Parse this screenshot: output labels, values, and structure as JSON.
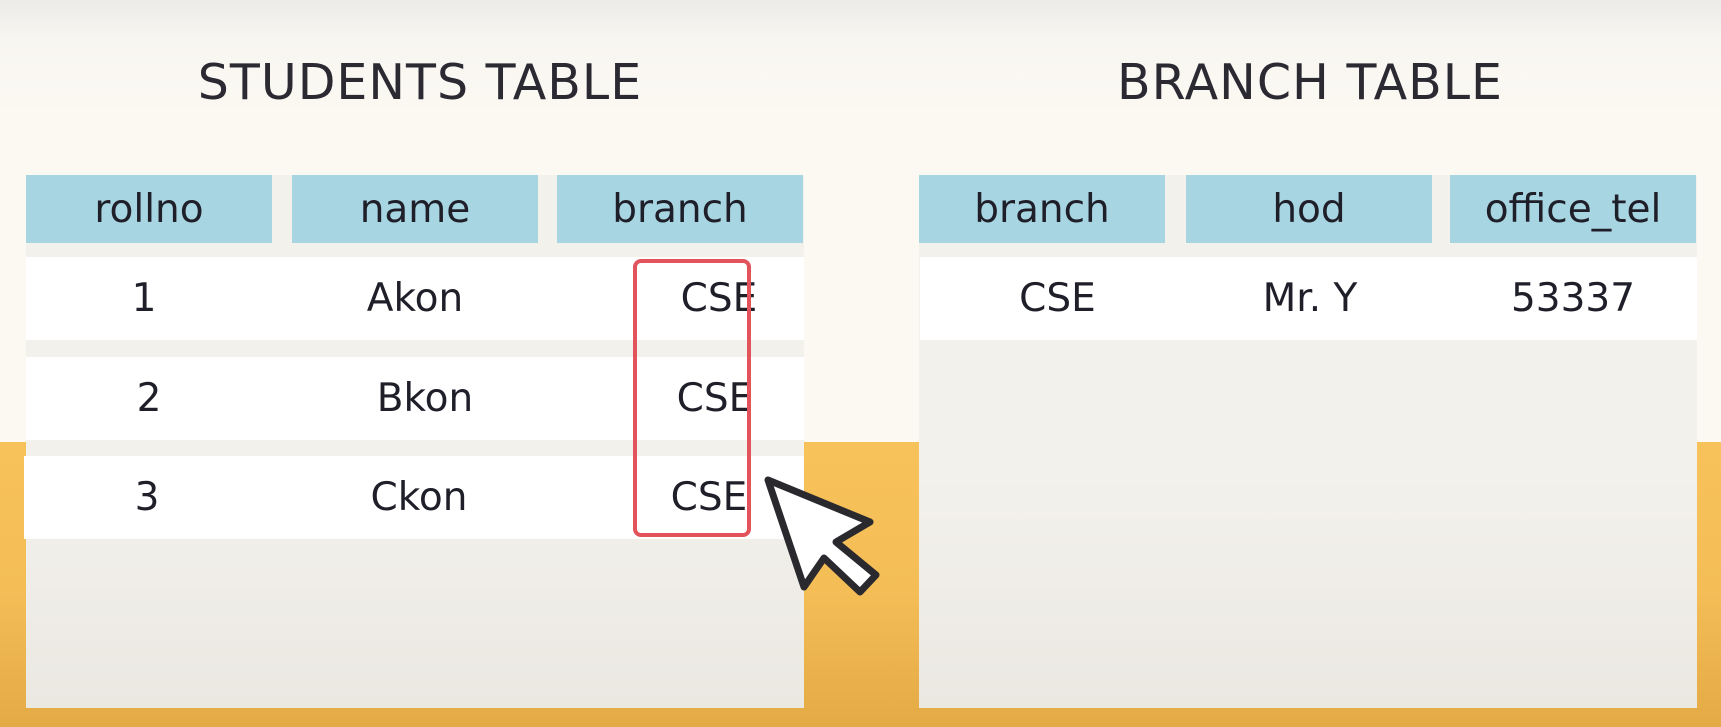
{
  "students": {
    "title": "STUDENTS TABLE",
    "columns": [
      "rollno",
      "name",
      "branch"
    ],
    "rows": [
      [
        "1",
        "Akon",
        "CSE"
      ],
      [
        "2",
        "Bkon",
        "CSE"
      ],
      [
        "3",
        "Ckon",
        "CSE"
      ]
    ]
  },
  "branch": {
    "title": "BRANCH TABLE",
    "columns": [
      "branch",
      "hod",
      "office_tel"
    ],
    "rows": [
      [
        "CSE",
        "Mr. Y",
        "53337"
      ]
    ]
  },
  "colors": {
    "header": "#a8d5e2",
    "highlight": "#e2535c",
    "background_top": "#fcf9f3",
    "background_bottom": "#f8c25a"
  },
  "icons": {
    "cursor": "mouse-pointer-icon"
  }
}
